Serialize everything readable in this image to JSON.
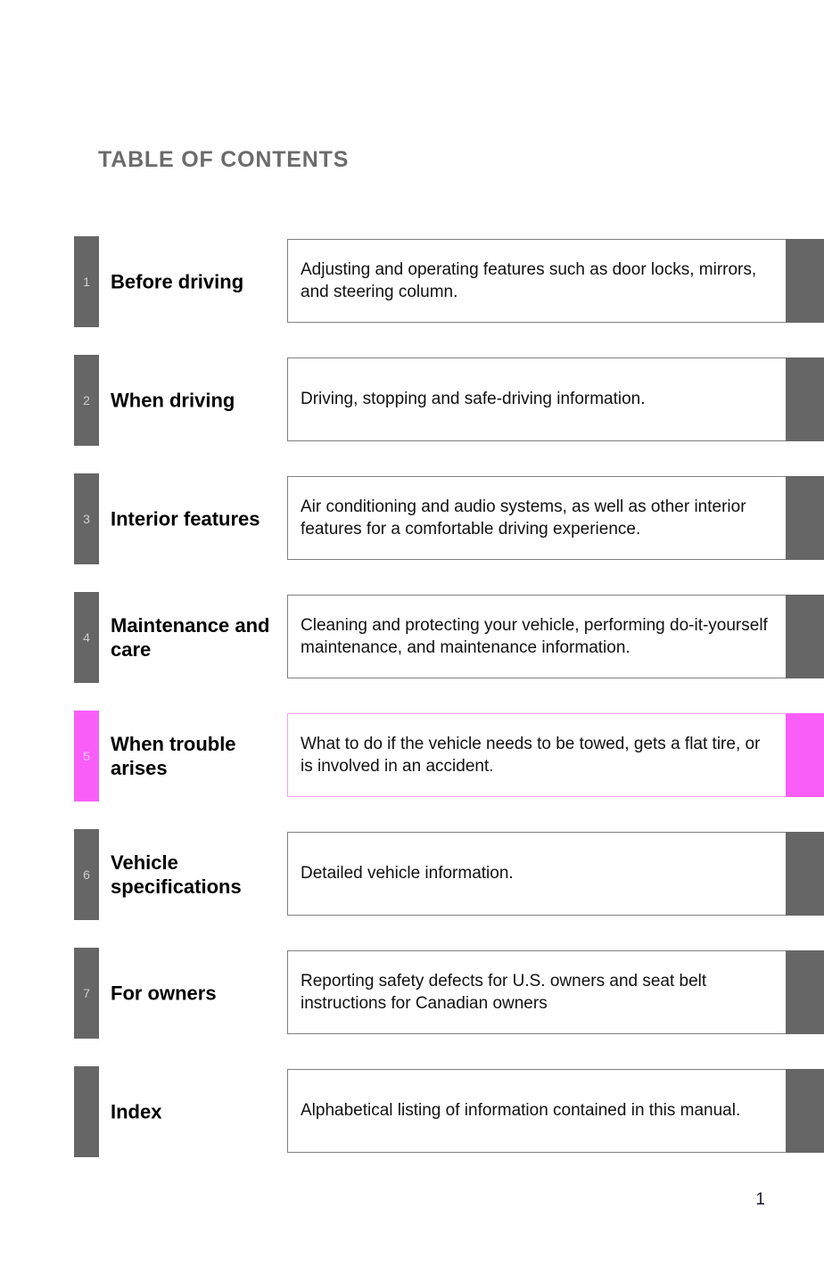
{
  "page": {
    "title": "TABLE OF CONTENTS",
    "page_number": "1",
    "colors": {
      "tab_gray": "#666666",
      "tab_highlight_magenta": "#f95ef9",
      "title_gray": "#6b6b6b",
      "box_border": "#808080",
      "box_border_highlight": "#e8a8e8"
    }
  },
  "toc": {
    "rows": [
      {
        "number": "1",
        "name": "Before driving",
        "description": "Adjusting and operating features such as door locks, mirrors, and steering column.",
        "highlighted": false
      },
      {
        "number": "2",
        "name": "When driving",
        "description": "Driving, stopping and safe-driving information.",
        "highlighted": false
      },
      {
        "number": "3",
        "name": "Interior features",
        "description": "Air conditioning and audio systems, as well as other interior features for a comfortable driving experience.",
        "highlighted": false
      },
      {
        "number": "4",
        "name": "Maintenance and care",
        "description": "Cleaning and protecting your vehicle, performing do-it-yourself maintenance, and maintenance information.",
        "highlighted": false
      },
      {
        "number": "5",
        "name": "When trouble arises",
        "description": "What to do if the vehicle needs to be towed, gets a flat tire, or is involved in an accident.",
        "highlighted": true
      },
      {
        "number": "6",
        "name": "Vehicle specifications",
        "description": "Detailed vehicle information.",
        "highlighted": false
      },
      {
        "number": "7",
        "name": "For owners",
        "description": "Reporting safety defects for U.S. owners and seat belt instructions for Canadian owners",
        "highlighted": false
      },
      {
        "number": "",
        "name": "Index",
        "description": "Alphabetical listing of information contained in this manual.",
        "highlighted": false
      }
    ]
  }
}
